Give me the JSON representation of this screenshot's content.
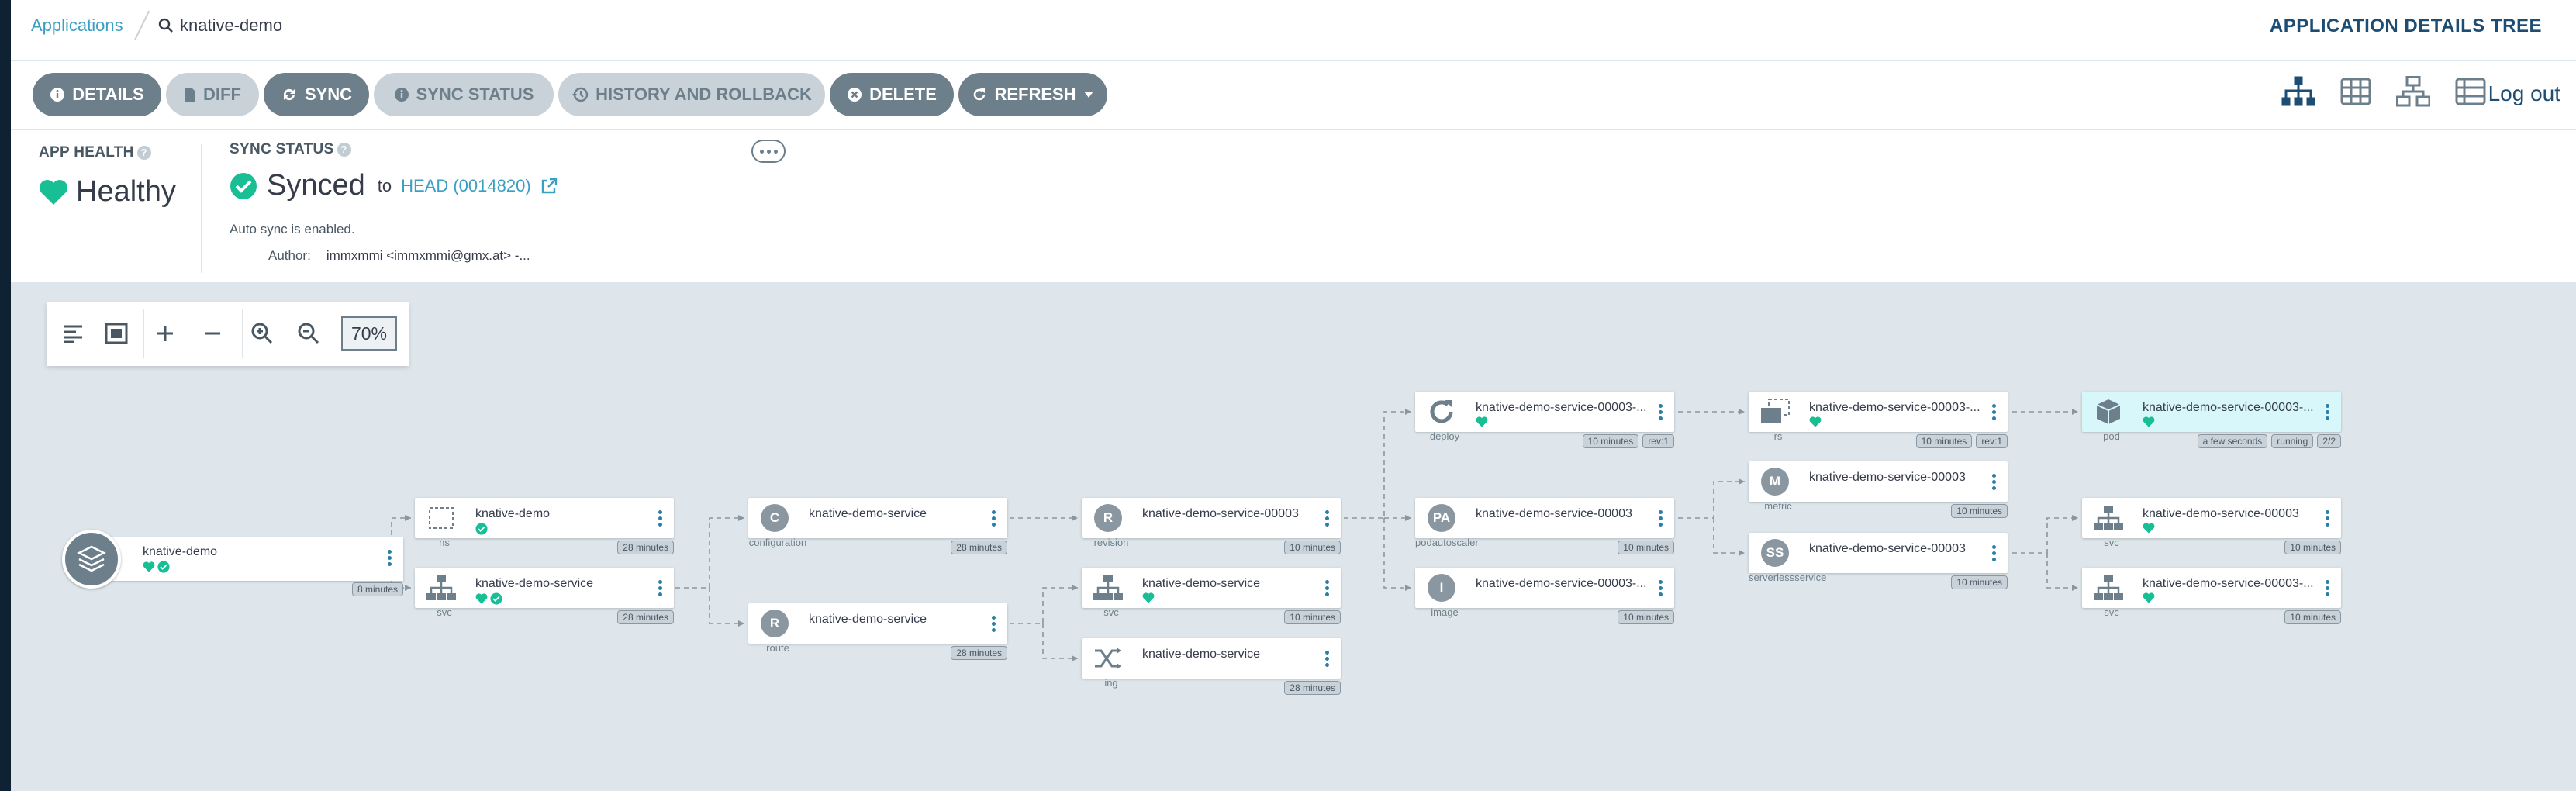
{
  "breadcrumb": {
    "app_link": "Applications",
    "app_name": "knative-demo"
  },
  "page_title": "APPLICATION DETAILS TREE",
  "toolbar": {
    "details": "DETAILS",
    "diff": "DIFF",
    "sync": "SYNC",
    "sync_status": "SYNC STATUS",
    "history": "HISTORY AND ROLLBACK",
    "delete": "DELETE",
    "refresh": "REFRESH"
  },
  "logout": "Log out",
  "status": {
    "app_health_label": "APP HEALTH",
    "app_health_value": "Healthy",
    "sync_status_label": "SYNC STATUS",
    "sync_value": "Synced",
    "sync_to": "to",
    "revision": "HEAD (0014820)",
    "auto_sync": "Auto sync is enabled.",
    "author_label": "Author:",
    "author_value": "immxmmi <immxmmi@gmx.at> -..."
  },
  "zoom": {
    "percent": "70%"
  },
  "colors": {
    "accent": "#3a9fc2",
    "healthy": "#18be94",
    "button_dark": "#6d7f8b",
    "pod_bg": "#d8f7fa"
  },
  "app": {
    "name": "knative-demo",
    "age": "8 minutes"
  },
  "nodes": [
    {
      "name": "knative-demo",
      "kind": "ns",
      "tags": [
        "28 minutes"
      ]
    },
    {
      "name": "knative-demo-service",
      "kind": "svc",
      "tags": [
        "28 minutes"
      ]
    },
    {
      "name": "knative-demo-service",
      "kind": "configuration",
      "letter": "C",
      "tags": [
        "28 minutes"
      ]
    },
    {
      "name": "knative-demo-service",
      "kind": "route",
      "letter": "R",
      "tags": [
        "28 minutes"
      ]
    },
    {
      "name": "knative-demo-service-00003",
      "kind": "revision",
      "letter": "R",
      "tags": [
        "10 minutes"
      ]
    },
    {
      "name": "knative-demo-service",
      "kind": "svc",
      "tags": [
        "10 minutes"
      ]
    },
    {
      "name": "knative-demo-service",
      "kind": "ing",
      "tags": [
        "28 minutes"
      ]
    },
    {
      "name": "knative-demo-service-00003-...",
      "kind": "deploy",
      "tags": [
        "10 minutes",
        "rev:1"
      ]
    },
    {
      "name": "knative-demo-service-00003",
      "kind": "podautoscaler",
      "letter": "PA",
      "tags": [
        "10 minutes"
      ]
    },
    {
      "name": "knative-demo-service-00003-...",
      "kind": "image",
      "letter": "I",
      "tags": [
        "10 minutes"
      ]
    },
    {
      "name": "knative-demo-service-00003-...",
      "kind": "rs",
      "tags": [
        "10 minutes",
        "rev:1"
      ]
    },
    {
      "name": "knative-demo-service-00003",
      "kind": "metric",
      "letter": "M",
      "tags": [
        "10 minutes"
      ]
    },
    {
      "name": "knative-demo-service-00003",
      "kind": "serverlessservice",
      "letter": "SS",
      "tags": [
        "10 minutes"
      ]
    },
    {
      "name": "knative-demo-service-00003-...",
      "kind": "pod",
      "tags": [
        "a few seconds",
        "running",
        "2/2"
      ]
    },
    {
      "name": "knative-demo-service-00003",
      "kind": "svc",
      "tags": [
        "10 minutes"
      ]
    },
    {
      "name": "knative-demo-service-00003-...",
      "kind": "svc",
      "tags": [
        "10 minutes"
      ]
    }
  ]
}
